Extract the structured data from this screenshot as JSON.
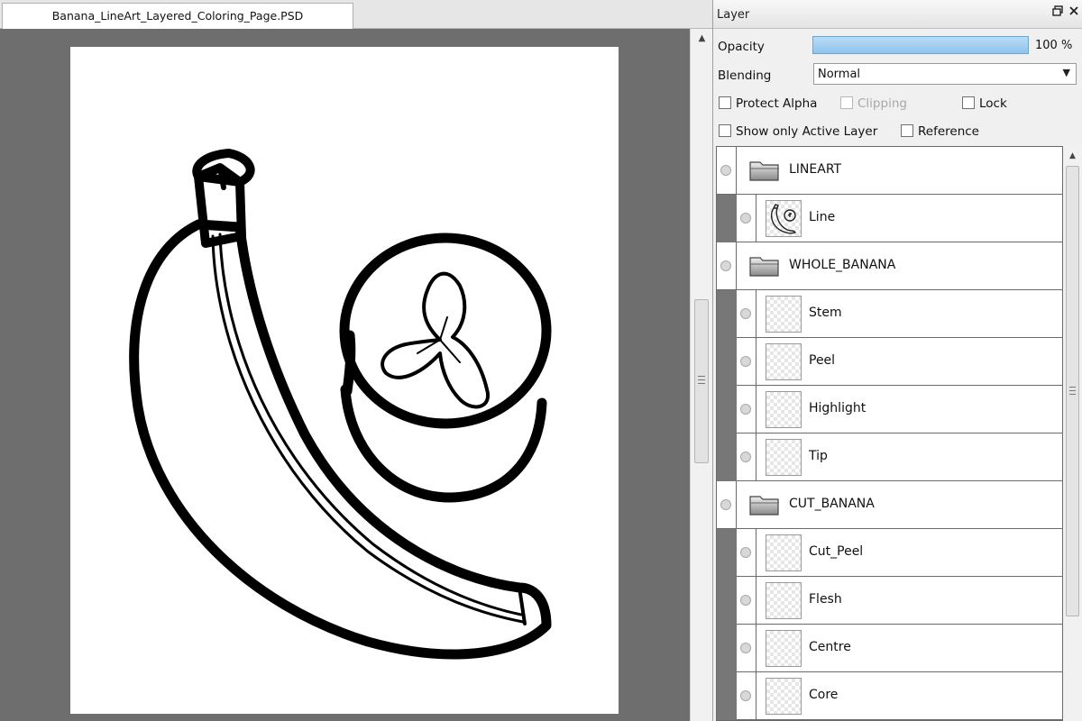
{
  "document": {
    "tab_title": "Banana_LineArt_Layered_Coloring_Page.PSD",
    "background_color": "#6e6e6e",
    "paper_color": "#ffffff"
  },
  "layer_panel": {
    "title": "Layer",
    "restore_icon": "restore-window-icon",
    "close_icon": "close-icon",
    "opacity_label": "Opacity",
    "opacity_value": 100,
    "opacity_text": "100 %",
    "blending_label": "Blending",
    "blending_value": "Normal",
    "checkboxes": {
      "protect_alpha": {
        "label": "Protect Alpha",
        "checked": false,
        "enabled": true
      },
      "clipping": {
        "label": "Clipping",
        "checked": false,
        "enabled": false
      },
      "lock": {
        "label": "Lock",
        "checked": false,
        "enabled": true
      },
      "show_only_active": {
        "label": "Show only Active Layer",
        "checked": false,
        "enabled": true
      },
      "reference": {
        "label": "Reference",
        "checked": false,
        "enabled": true
      }
    },
    "layers": [
      {
        "type": "group",
        "name": "LINEART"
      },
      {
        "type": "layer",
        "name": "Line",
        "thumbnail": "banana-lineart-thumbnail"
      },
      {
        "type": "group",
        "name": "WHOLE_BANANA"
      },
      {
        "type": "layer",
        "name": "Stem",
        "thumbnail": "transparent"
      },
      {
        "type": "layer",
        "name": "Peel",
        "thumbnail": "transparent"
      },
      {
        "type": "layer",
        "name": "Highlight",
        "thumbnail": "transparent"
      },
      {
        "type": "layer",
        "name": "Tip",
        "thumbnail": "transparent"
      },
      {
        "type": "group",
        "name": "CUT_BANANA"
      },
      {
        "type": "layer",
        "name": "Cut_Peel",
        "thumbnail": "transparent"
      },
      {
        "type": "layer",
        "name": "Flesh",
        "thumbnail": "transparent"
      },
      {
        "type": "layer",
        "name": "Centre",
        "thumbnail": "transparent"
      },
      {
        "type": "layer",
        "name": "Core",
        "thumbnail": "transparent"
      }
    ]
  }
}
